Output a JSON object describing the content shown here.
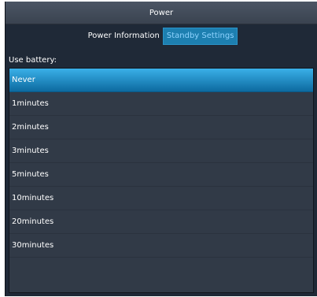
{
  "window": {
    "title": "Power"
  },
  "tabs": [
    {
      "label": "Power Information",
      "active": false
    },
    {
      "label": "Standby Settings",
      "active": true
    }
  ],
  "section": {
    "label": "Use battery:"
  },
  "options": [
    {
      "label": "Never",
      "selected": true
    },
    {
      "label": "1minutes",
      "selected": false
    },
    {
      "label": "2minutes",
      "selected": false
    },
    {
      "label": "3minutes",
      "selected": false
    },
    {
      "label": "5minutes",
      "selected": false
    },
    {
      "label": "10minutes",
      "selected": false
    },
    {
      "label": "20minutes",
      "selected": false
    },
    {
      "label": "30minutes",
      "selected": false
    }
  ],
  "colors": {
    "background": "#1f2937",
    "list_background": "#313a47",
    "selection": "#1a8fd0",
    "active_tab": "#1d7fb0"
  }
}
